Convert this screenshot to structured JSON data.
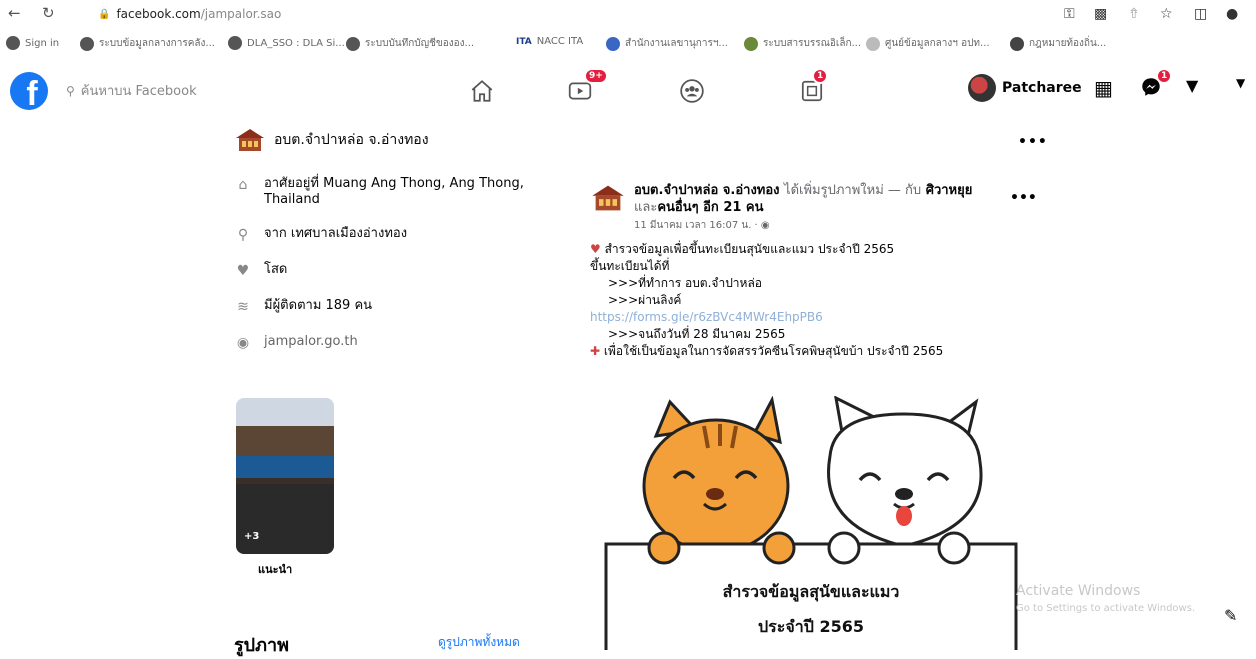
{
  "browser": {
    "url_host": "facebook.com",
    "url_path": "/jampalor.sao",
    "bookmarks": [
      {
        "label": "Sign in"
      },
      {
        "label": "ระบบข้อมูลกลางการคลัง..."
      },
      {
        "label": "DLA_SSO : DLA Si..."
      },
      {
        "label": "ระบบบันทึกบัญชีขององ..."
      },
      {
        "label": "NACC ITA",
        "tag": "ITA"
      },
      {
        "label": "สำนักงานเลขานุการฯ..."
      },
      {
        "label": "ระบบสารบรรณอิเล็ก..."
      },
      {
        "label": "ศูนย์ข้อมูลกลางฯ อปท..."
      },
      {
        "label": "กฎหมายท้องถิ่น..."
      }
    ]
  },
  "fb": {
    "logo": "f",
    "search_placeholder": "ค้นหาบน Facebook",
    "video_badge": "9+",
    "pages_badge": "1",
    "profile_name": "Patcharee",
    "messenger_badge": "1",
    "accent": "#1877f2",
    "badge_color": "#e41e3f"
  },
  "intro": {
    "page_name": "อบต.จำปาหล่อ จ.อ่างทอง",
    "lives": "อาศัยอยู่ที่ Muang Ang Thong, Ang Thong, Thailand",
    "from": "จาก เทศบาลเมืองอ่างทอง",
    "relationship": "โสด",
    "followers": "มีผู้ติดตาม 189 คน",
    "website": "jampalor.go.th",
    "thumb_count": "+3",
    "recommend": "แนะนำ",
    "photos_title": "รูปภาพ",
    "photos_all": "ดูรูปภาพทั้งหมด"
  },
  "post": {
    "author": "อบต.จำปาหล่อ จ.อ่างทอง",
    "action": "ได้เพิ่มรูปภาพใหม่ — กับ",
    "tag_name": "ศิวาหยุย",
    "tag_and": "และ",
    "others": "คนอื่นๆ อีก 21 คน",
    "time": "11 มีนาคม เวลา 16:07 น. · ",
    "lines": [
      "สำรวจข้อมูลเพื่อขึ้นทะเบียนสุนัขและแมว ประจำปี 2565",
      "ขึ้นทะเบียนได้ที่",
      ">>>ที่ทำการ อบต.จำปาหล่อ",
      ">>>ผ่านลิงค์"
    ],
    "link": "https://forms.gle/r6zBVc4MWr4EhpPB6",
    "line_deadline": ">>>จนถึงวันที่ 28 มีนาคม 2565",
    "line_purpose": "เพื่อใช้เป็นข้อมูลในการจัดสรรวัคซีนโรคพิษสุนัขบ้า ประจำปี 2565",
    "sign_line1": "สำรวจข้อมูลสุนัขและแมว",
    "sign_line2": "ประจำปี 2565"
  },
  "watermark": {
    "line1": "Activate Windows",
    "line2": "Go to Settings to activate Windows."
  }
}
